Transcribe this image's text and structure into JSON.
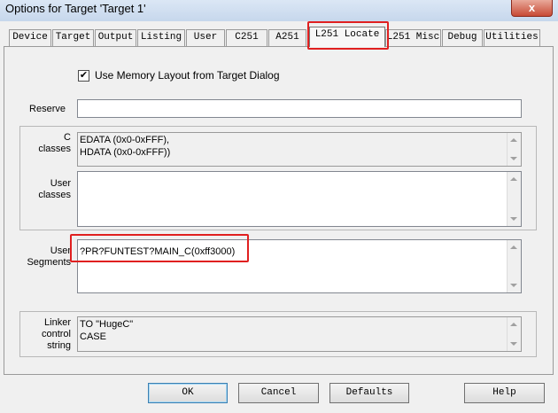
{
  "window": {
    "title": "Options for Target 'Target 1'",
    "close_glyph": "x"
  },
  "tabs": [
    {
      "label": "Device"
    },
    {
      "label": "Target"
    },
    {
      "label": "Output"
    },
    {
      "label": "Listing"
    },
    {
      "label": "User"
    },
    {
      "label": "C251"
    },
    {
      "label": "A251"
    },
    {
      "label": "L251 Locate"
    },
    {
      "label": "L251 Misc"
    },
    {
      "label": "Debug"
    },
    {
      "label": "Utilities"
    }
  ],
  "active_tab": "L251 Locate",
  "use_memory_layout": {
    "label": "Use Memory Layout from Target Dialog",
    "checked": true,
    "glyph": "✔"
  },
  "reserve": {
    "label": "Reserve",
    "value": ""
  },
  "c_classes": {
    "label1": "C",
    "label2": "classes",
    "value": "EDATA (0x0-0xFFF),\nHDATA (0x0-0xFFF))"
  },
  "user_classes": {
    "label1": "User",
    "label2": "classes",
    "value": ""
  },
  "user_segments": {
    "label1": "User",
    "label2": "Segments",
    "value": "?PR?FUNTEST?MAIN_C(0xff3000)"
  },
  "linker_control": {
    "label1": "Linker",
    "label2": "control",
    "label3": "string",
    "value": "TO \"HugeC\"\nCASE"
  },
  "buttons": {
    "ok": "OK",
    "cancel": "Cancel",
    "defaults": "Defaults",
    "help": "Help"
  },
  "highlight_color": "#e02020"
}
